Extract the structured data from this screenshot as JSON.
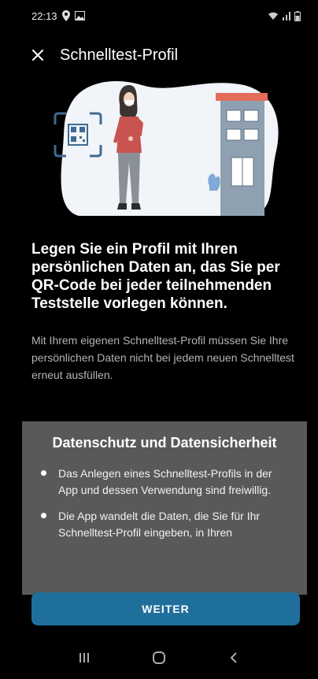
{
  "status_bar": {
    "time": "22:13"
  },
  "app_bar": {
    "title": "Schnelltest-Profil",
    "close_icon": "close-icon"
  },
  "headline": "Legen Sie ein Profil mit Ihren persönlichen Daten an, das Sie per QR-Code bei jeder teilnehmenden Teststelle vorlegen können.",
  "body_text": "Mit Ihrem eigenen Schnelltest-Profil müssen Sie Ihre persönlichen Daten nicht bei jedem neuen Schnelltest erneut ausfüllen.",
  "privacy": {
    "title": "Datenschutz und Datensicherheit",
    "items": [
      "Das Anlegen eines Schnelltest-Profils in der App und dessen Verwendung sind freiwillig.",
      "Die App wandelt die Daten, die Sie für Ihr Schnelltest-Profil eingeben, in Ihren"
    ]
  },
  "button": {
    "label": "WEITER"
  },
  "colors": {
    "accent": "#1f6f9c",
    "card": "#595959",
    "background": "#000000"
  }
}
